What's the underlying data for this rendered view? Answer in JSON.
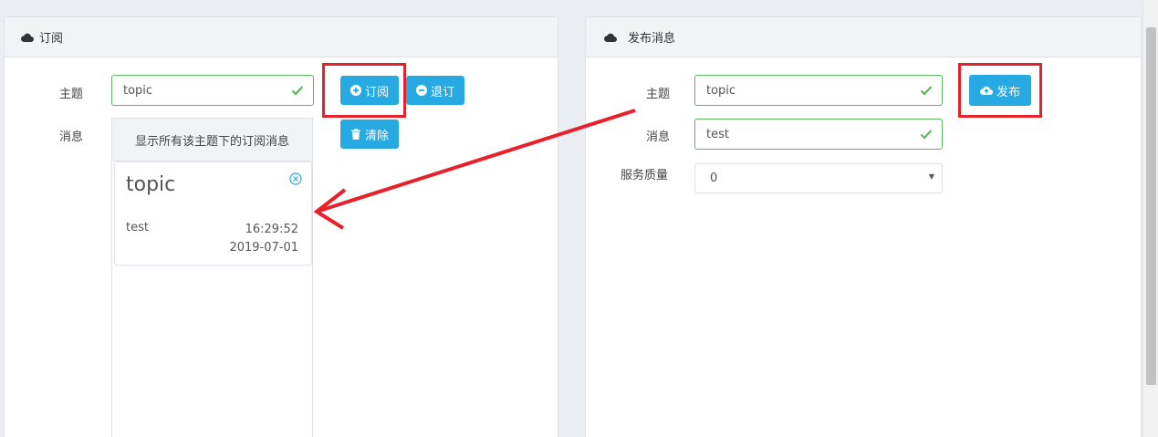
{
  "subscribe_panel": {
    "title": "订阅",
    "topic_label": "主题",
    "topic_value": "topic",
    "message_label": "消息",
    "subscribe_button": "订阅",
    "unsubscribe_button": "退订",
    "clear_button": "清除",
    "messages_header": "显示所有该主题下的订阅消息",
    "messages": [
      {
        "topic": "topic",
        "content": "test",
        "time": "16:29:52",
        "date": "2019-07-01"
      }
    ]
  },
  "publish_panel": {
    "title": "发布消息",
    "topic_label": "主题",
    "topic_value": "topic",
    "message_label": "消息",
    "message_value": "test",
    "qos_label": "服务质量",
    "qos_value": "0",
    "publish_button": "发布"
  },
  "colors": {
    "accent": "#27a9e1",
    "valid": "#5cb85c",
    "highlight": "#e8202a"
  },
  "icons": [
    "cloud-icon",
    "check-icon",
    "plus-circle-icon",
    "minus-circle-icon",
    "trash-icon",
    "close-circle-icon",
    "cloud-upload-icon"
  ]
}
